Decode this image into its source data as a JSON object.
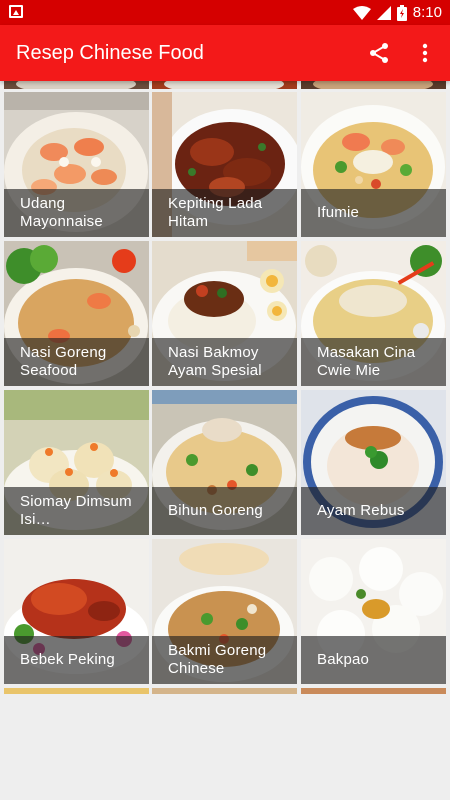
{
  "status_bar": {
    "time": "8:10"
  },
  "app_bar": {
    "title": "Resep Chinese Food"
  },
  "recipes": [
    {
      "name": "Udang Mayonnaise"
    },
    {
      "name": "Kepiting Lada Hitam"
    },
    {
      "name": "Ifumie"
    },
    {
      "name": "Nasi Goreng Seafood"
    },
    {
      "name": "Nasi Bakmoy Ayam Spesial"
    },
    {
      "name": "Masakan Cina Cwie Mie"
    },
    {
      "name": "Siomay Dimsum Isi…"
    },
    {
      "name": "Bihun Goreng"
    },
    {
      "name": "Ayam Rebus"
    },
    {
      "name": "Bebek Peking"
    },
    {
      "name": "Bakmi Goreng Chinese"
    },
    {
      "name": "Bakpao"
    }
  ],
  "colors": {
    "status_bar": "#d50000",
    "app_bar": "#f31919",
    "background": "#eeeeee"
  }
}
